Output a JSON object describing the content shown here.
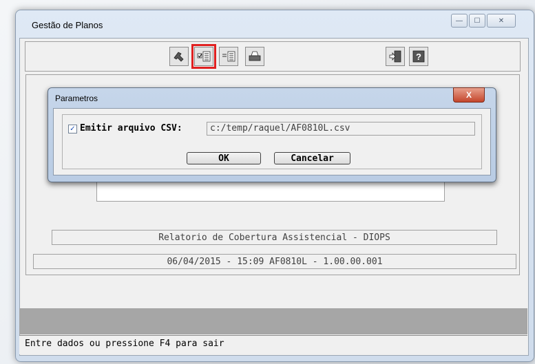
{
  "window": {
    "title": "Gestão de Planos",
    "minimize_glyph": "—",
    "maximize_glyph": "☐",
    "close_glyph": "✕"
  },
  "toolbar": {
    "buttons": [
      {
        "icon": "tools-icon"
      },
      {
        "icon": "checklist-icon",
        "highlighted": true
      },
      {
        "icon": "list-icon"
      },
      {
        "icon": "print-icon"
      },
      {
        "icon": "exit-door-icon"
      },
      {
        "icon": "help-icon"
      }
    ],
    "highlight_color": "#e02020"
  },
  "main": {
    "report_title": "Relatorio de Cobertura Assistencial - DIOPS",
    "info_line": "06/04/2015 - 15:09  AF0810L - 1.00.00.001"
  },
  "dialog": {
    "title": "Parametros",
    "close_glyph": "X",
    "checkbox_label": "Emitir arquivo CSV:",
    "checkbox_checked": true,
    "checkbox_glyph": "✓",
    "csv_path": "c:/temp/raquel/AF0810L.csv",
    "ok_label": "OK",
    "cancel_label": "Cancelar"
  },
  "status": {
    "text": "Entre dados ou pressione F4 para sair"
  },
  "colors": {
    "close_button": "#c4462c",
    "status_gray": "#a6a6a6"
  }
}
